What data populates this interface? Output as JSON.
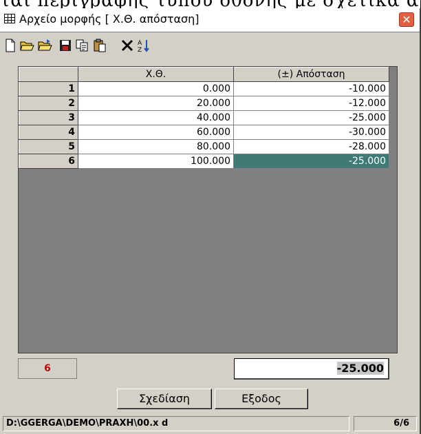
{
  "background_text": "ται περιγραφής τύπου οθόνης με σχετικά αρχείου",
  "window": {
    "title": "Αρχείο μορφής [ Χ.Θ.  απόσταση]",
    "title_icon": "table-icon",
    "close_icon": "close-icon"
  },
  "toolbar": {
    "buttons": [
      {
        "icon": "new-file-icon"
      },
      {
        "icon": "open-folder-icon"
      },
      {
        "icon": "open-folder-alt-icon"
      },
      {
        "icon": "save-icon"
      },
      {
        "icon": "copy-icon"
      },
      {
        "icon": "paste-icon"
      },
      {
        "icon": "delete-icon"
      },
      {
        "icon": "sort-az-icon"
      }
    ]
  },
  "grid": {
    "columns": [
      "Χ.Θ.",
      "(±) Απόσταση"
    ],
    "rows": [
      {
        "num": "1",
        "xth": "0.000",
        "dist": "-10.000"
      },
      {
        "num": "2",
        "xth": "20.000",
        "dist": "-12.000"
      },
      {
        "num": "3",
        "xth": "40.000",
        "dist": "-25.000"
      },
      {
        "num": "4",
        "xth": "60.000",
        "dist": "-30.000"
      },
      {
        "num": "5",
        "xth": "80.000",
        "dist": "-28.000"
      },
      {
        "num": "6",
        "xth": "100.000",
        "dist": "-25.000"
      }
    ],
    "selected_cell": {
      "row": 6,
      "column": "(±) Απόσταση"
    },
    "selected_color": "#3f7a76"
  },
  "editor": {
    "row_number": "6",
    "value": "-25.000"
  },
  "buttons": {
    "draw_label": "Σχεδίαση",
    "exit_label": "Εξοδος"
  },
  "status": {
    "path": "D:\\GGERGA\\DEMO\\PRAXH\\00.x d",
    "count": "6/6"
  }
}
